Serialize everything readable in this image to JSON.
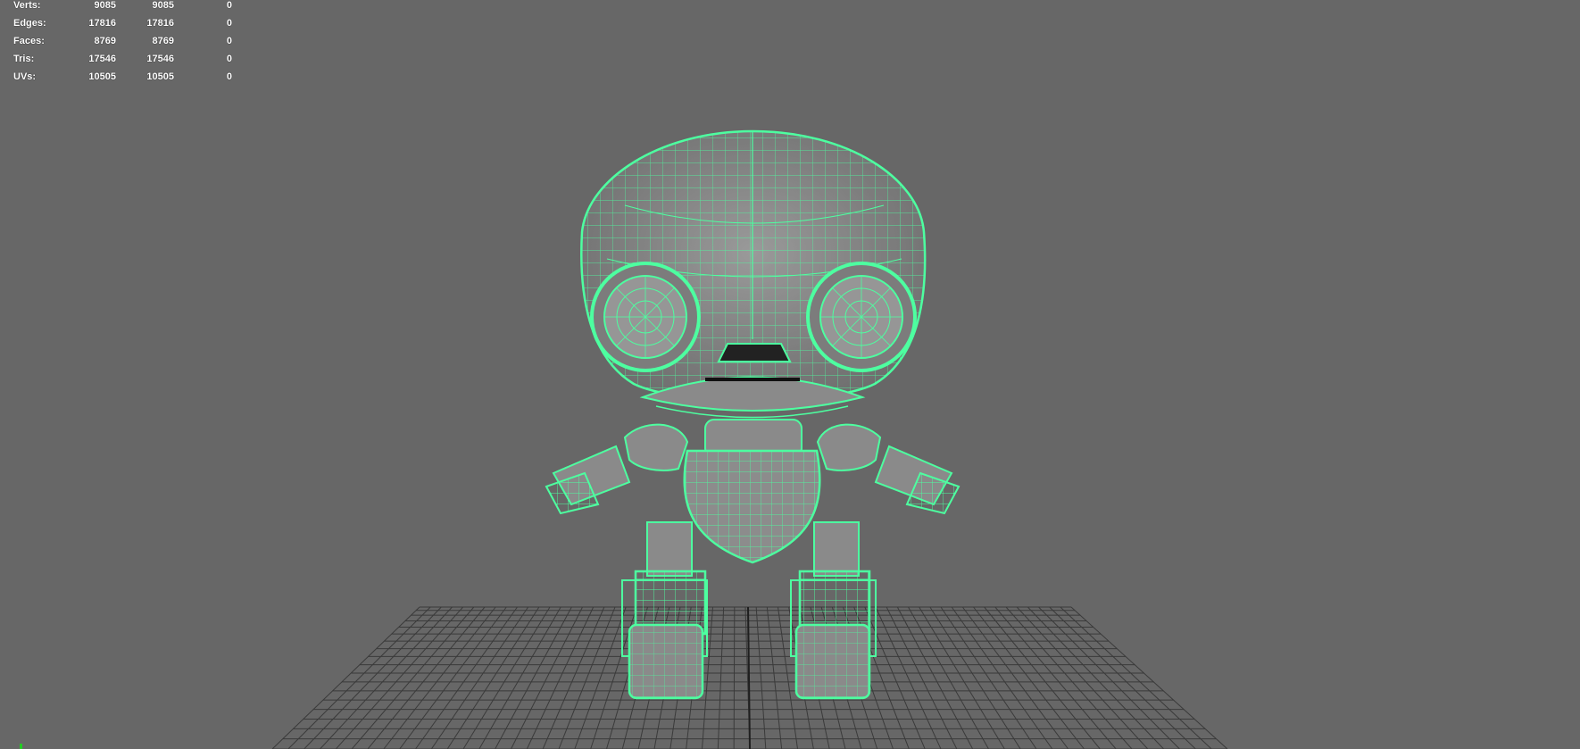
{
  "hud": {
    "rows": [
      {
        "label": "Verts:",
        "v1": "9085",
        "v2": "9085",
        "v3": "0"
      },
      {
        "label": "Edges:",
        "v1": "17816",
        "v2": "17816",
        "v3": "0"
      },
      {
        "label": "Faces:",
        "v1": "8769",
        "v2": "8769",
        "v3": "0"
      },
      {
        "label": "Tris:",
        "v1": "17546",
        "v2": "17546",
        "v3": "0"
      },
      {
        "label": "UVs:",
        "v1": "10505",
        "v2": "10505",
        "v3": "0"
      }
    ]
  },
  "colors": {
    "background": "#676767",
    "grid": "#3a3a3a",
    "wireframe": "#4dffa0",
    "mesh_fill": "#8a8a8a"
  },
  "icons": {
    "axis": "view-axis-icon"
  }
}
